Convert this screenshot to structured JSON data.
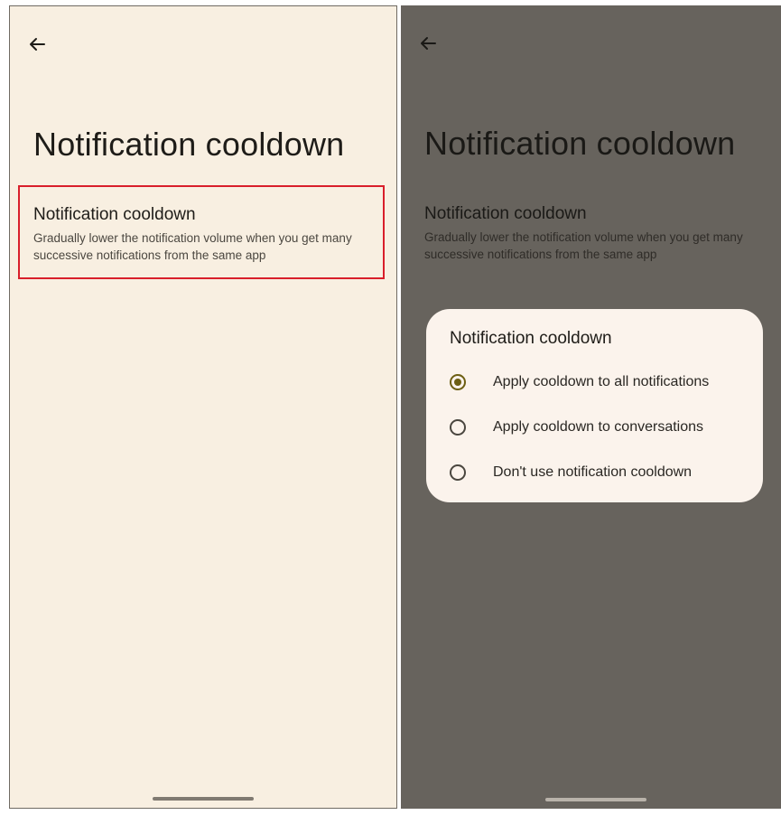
{
  "left_screen": {
    "page_title": "Notification cooldown",
    "setting": {
      "title": "Notification cooldown",
      "description": "Gradually lower the notification volume when you get many successive notifications from the same app"
    }
  },
  "right_screen": {
    "page_title": "Notification cooldown",
    "setting": {
      "title": "Notification cooldown",
      "description": "Gradually lower the notification volume when you get many successive notifications from the same app"
    },
    "dialog": {
      "title": "Notification cooldown",
      "options": [
        {
          "label": "Apply cooldown to all notifications",
          "selected": true
        },
        {
          "label": "Apply cooldown to conversations",
          "selected": false
        },
        {
          "label": "Don't use notification cooldown",
          "selected": false
        }
      ]
    }
  },
  "colors": {
    "left_background": "#f8efe1",
    "right_scrim_background": "#67635d",
    "dialog_background": "#fbf3ec",
    "highlight_border": "#d91f2b",
    "radio_selected": "#6d5f13"
  },
  "icons": {
    "back": "arrow-left-icon"
  }
}
